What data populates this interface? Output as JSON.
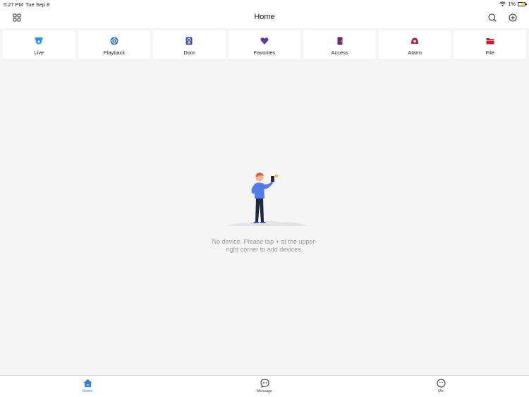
{
  "status_bar": {
    "time": "5:27 PM",
    "date": "Tue Sep 8",
    "battery": "1%"
  },
  "header": {
    "title": "Home"
  },
  "quick_access": [
    {
      "label": "Live",
      "icon": "camera-icon",
      "color": "#2b8ef0"
    },
    {
      "label": "Playback",
      "icon": "playback-icon",
      "color": "#2b6fd6"
    },
    {
      "label": "Door",
      "icon": "door-phone-icon",
      "color": "#3a4fa8"
    },
    {
      "label": "Favorites",
      "icon": "heart-icon",
      "color": "#5b3a9e"
    },
    {
      "label": "Access",
      "icon": "access-door-icon",
      "color": "#6b2a6a"
    },
    {
      "label": "Alarm",
      "icon": "alarm-icon",
      "color": "#a8254a"
    },
    {
      "label": "File",
      "icon": "folder-icon",
      "color": "#c2202e"
    }
  ],
  "empty_state": {
    "message_line1": "No device. Please tap + at the upper-",
    "message_line2": "right corner to add devices."
  },
  "tab_bar": {
    "home": "Home",
    "message": "Message",
    "me": "Me",
    "active_color": "#2b7fe0"
  }
}
